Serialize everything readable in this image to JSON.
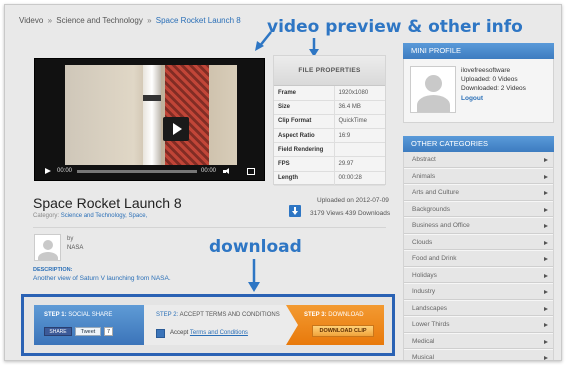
{
  "breadcrumb": {
    "items": [
      "Videvo",
      "Science and Technology"
    ],
    "separator": "»",
    "current": "Space Rocket Launch 8"
  },
  "annotations": {
    "preview": "video preview & other info",
    "download": "download",
    "color": "#2e76c4"
  },
  "player": {
    "time_elapsed": "00:00",
    "time_total": "00:00"
  },
  "file_properties": {
    "title": "FILE PROPERTIES",
    "rows": [
      {
        "key": "Frame",
        "value": "1920x1080"
      },
      {
        "key": "Size",
        "value": "36.4 MB"
      },
      {
        "key": "Clip Format",
        "value": "QuickTime"
      },
      {
        "key": "Aspect Ratio",
        "value": "16:9"
      },
      {
        "key": "Field Rendering",
        "value": ""
      },
      {
        "key": "FPS",
        "value": "29.97"
      },
      {
        "key": "Length",
        "value": "00:00:28"
      }
    ]
  },
  "clip": {
    "title": "Space Rocket Launch 8",
    "category_label": "Category:",
    "categories": "Science and Technology, Space,",
    "uploaded": "Uploaded on 2012-07-09",
    "stats": "3179 Views 439 Downloads",
    "by_label": "by",
    "author": "NASA",
    "description_label": "DESCRIPTION:",
    "description": "Another view of Saturn V launching from NASA."
  },
  "steps": {
    "step1_num": "STEP 1:",
    "step1_label": "SOCIAL SHARE",
    "share_label": "SHARE",
    "tweet_label": "Tweet",
    "tweet_count": "7",
    "step2_num": "STEP 2:",
    "step2_label": "ACCEPT TERMS AND CONDITIONS",
    "accept_prefix": "Accept",
    "accept_link": "Terms and Conditions",
    "step3_num": "STEP 3:",
    "step3_label": "DOWNLOAD",
    "download_button": "DOWNLOAD CLIP"
  },
  "mini_profile": {
    "title": "MINI PROFILE",
    "username": "ilovefreesoftware",
    "uploaded": "Uploaded: 0 Videos",
    "downloaded": "Downloaded: 2 Videos",
    "logout": "Logout"
  },
  "other_categories": {
    "title": "OTHER CATEGORIES",
    "items": [
      "Abstract",
      "Animals",
      "Arts and Culture",
      "Backgrounds",
      "Business and Office",
      "Clouds",
      "Food and Drink",
      "Holidays",
      "Industry",
      "Landscapes",
      "Lower Thirds",
      "Medical",
      "Musical"
    ]
  },
  "colors": {
    "accent_blue": "#2a6fb7",
    "panel_header": "#3d7cc0",
    "download_orange": "#e8790b"
  }
}
